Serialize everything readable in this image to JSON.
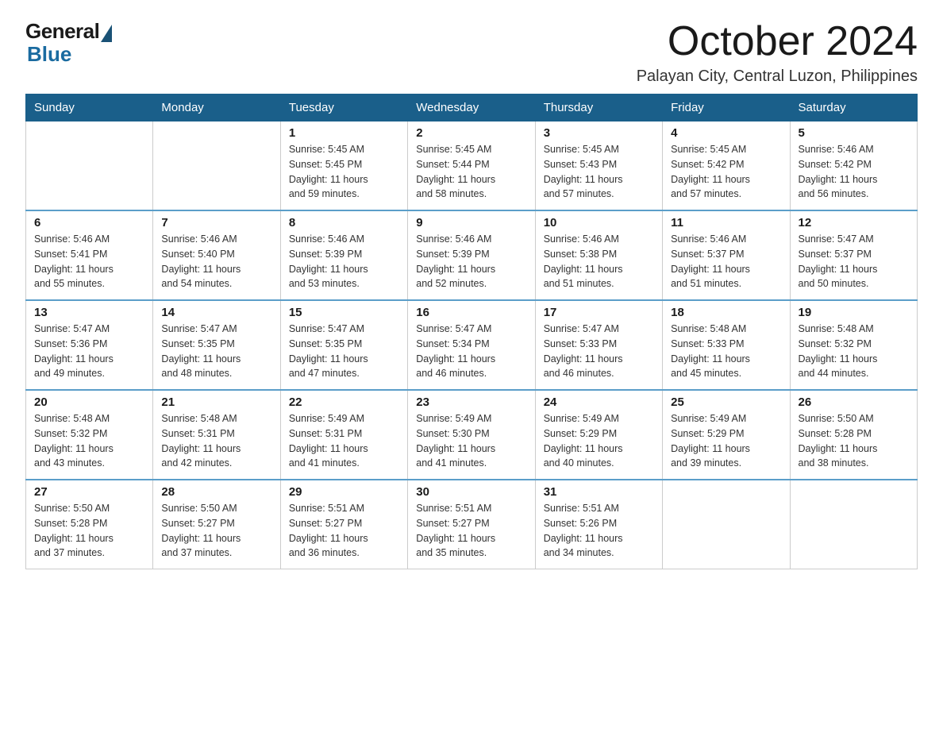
{
  "header": {
    "logo_general": "General",
    "logo_blue": "Blue",
    "month_year": "October 2024",
    "location": "Palayan City, Central Luzon, Philippines"
  },
  "days_of_week": [
    "Sunday",
    "Monday",
    "Tuesday",
    "Wednesday",
    "Thursday",
    "Friday",
    "Saturday"
  ],
  "weeks": [
    [
      {
        "day": "",
        "info": ""
      },
      {
        "day": "",
        "info": ""
      },
      {
        "day": "1",
        "info": "Sunrise: 5:45 AM\nSunset: 5:45 PM\nDaylight: 11 hours\nand 59 minutes."
      },
      {
        "day": "2",
        "info": "Sunrise: 5:45 AM\nSunset: 5:44 PM\nDaylight: 11 hours\nand 58 minutes."
      },
      {
        "day": "3",
        "info": "Sunrise: 5:45 AM\nSunset: 5:43 PM\nDaylight: 11 hours\nand 57 minutes."
      },
      {
        "day": "4",
        "info": "Sunrise: 5:45 AM\nSunset: 5:42 PM\nDaylight: 11 hours\nand 57 minutes."
      },
      {
        "day": "5",
        "info": "Sunrise: 5:46 AM\nSunset: 5:42 PM\nDaylight: 11 hours\nand 56 minutes."
      }
    ],
    [
      {
        "day": "6",
        "info": "Sunrise: 5:46 AM\nSunset: 5:41 PM\nDaylight: 11 hours\nand 55 minutes."
      },
      {
        "day": "7",
        "info": "Sunrise: 5:46 AM\nSunset: 5:40 PM\nDaylight: 11 hours\nand 54 minutes."
      },
      {
        "day": "8",
        "info": "Sunrise: 5:46 AM\nSunset: 5:39 PM\nDaylight: 11 hours\nand 53 minutes."
      },
      {
        "day": "9",
        "info": "Sunrise: 5:46 AM\nSunset: 5:39 PM\nDaylight: 11 hours\nand 52 minutes."
      },
      {
        "day": "10",
        "info": "Sunrise: 5:46 AM\nSunset: 5:38 PM\nDaylight: 11 hours\nand 51 minutes."
      },
      {
        "day": "11",
        "info": "Sunrise: 5:46 AM\nSunset: 5:37 PM\nDaylight: 11 hours\nand 51 minutes."
      },
      {
        "day": "12",
        "info": "Sunrise: 5:47 AM\nSunset: 5:37 PM\nDaylight: 11 hours\nand 50 minutes."
      }
    ],
    [
      {
        "day": "13",
        "info": "Sunrise: 5:47 AM\nSunset: 5:36 PM\nDaylight: 11 hours\nand 49 minutes."
      },
      {
        "day": "14",
        "info": "Sunrise: 5:47 AM\nSunset: 5:35 PM\nDaylight: 11 hours\nand 48 minutes."
      },
      {
        "day": "15",
        "info": "Sunrise: 5:47 AM\nSunset: 5:35 PM\nDaylight: 11 hours\nand 47 minutes."
      },
      {
        "day": "16",
        "info": "Sunrise: 5:47 AM\nSunset: 5:34 PM\nDaylight: 11 hours\nand 46 minutes."
      },
      {
        "day": "17",
        "info": "Sunrise: 5:47 AM\nSunset: 5:33 PM\nDaylight: 11 hours\nand 46 minutes."
      },
      {
        "day": "18",
        "info": "Sunrise: 5:48 AM\nSunset: 5:33 PM\nDaylight: 11 hours\nand 45 minutes."
      },
      {
        "day": "19",
        "info": "Sunrise: 5:48 AM\nSunset: 5:32 PM\nDaylight: 11 hours\nand 44 minutes."
      }
    ],
    [
      {
        "day": "20",
        "info": "Sunrise: 5:48 AM\nSunset: 5:32 PM\nDaylight: 11 hours\nand 43 minutes."
      },
      {
        "day": "21",
        "info": "Sunrise: 5:48 AM\nSunset: 5:31 PM\nDaylight: 11 hours\nand 42 minutes."
      },
      {
        "day": "22",
        "info": "Sunrise: 5:49 AM\nSunset: 5:31 PM\nDaylight: 11 hours\nand 41 minutes."
      },
      {
        "day": "23",
        "info": "Sunrise: 5:49 AM\nSunset: 5:30 PM\nDaylight: 11 hours\nand 41 minutes."
      },
      {
        "day": "24",
        "info": "Sunrise: 5:49 AM\nSunset: 5:29 PM\nDaylight: 11 hours\nand 40 minutes."
      },
      {
        "day": "25",
        "info": "Sunrise: 5:49 AM\nSunset: 5:29 PM\nDaylight: 11 hours\nand 39 minutes."
      },
      {
        "day": "26",
        "info": "Sunrise: 5:50 AM\nSunset: 5:28 PM\nDaylight: 11 hours\nand 38 minutes."
      }
    ],
    [
      {
        "day": "27",
        "info": "Sunrise: 5:50 AM\nSunset: 5:28 PM\nDaylight: 11 hours\nand 37 minutes."
      },
      {
        "day": "28",
        "info": "Sunrise: 5:50 AM\nSunset: 5:27 PM\nDaylight: 11 hours\nand 37 minutes."
      },
      {
        "day": "29",
        "info": "Sunrise: 5:51 AM\nSunset: 5:27 PM\nDaylight: 11 hours\nand 36 minutes."
      },
      {
        "day": "30",
        "info": "Sunrise: 5:51 AM\nSunset: 5:27 PM\nDaylight: 11 hours\nand 35 minutes."
      },
      {
        "day": "31",
        "info": "Sunrise: 5:51 AM\nSunset: 5:26 PM\nDaylight: 11 hours\nand 34 minutes."
      },
      {
        "day": "",
        "info": ""
      },
      {
        "day": "",
        "info": ""
      }
    ]
  ]
}
